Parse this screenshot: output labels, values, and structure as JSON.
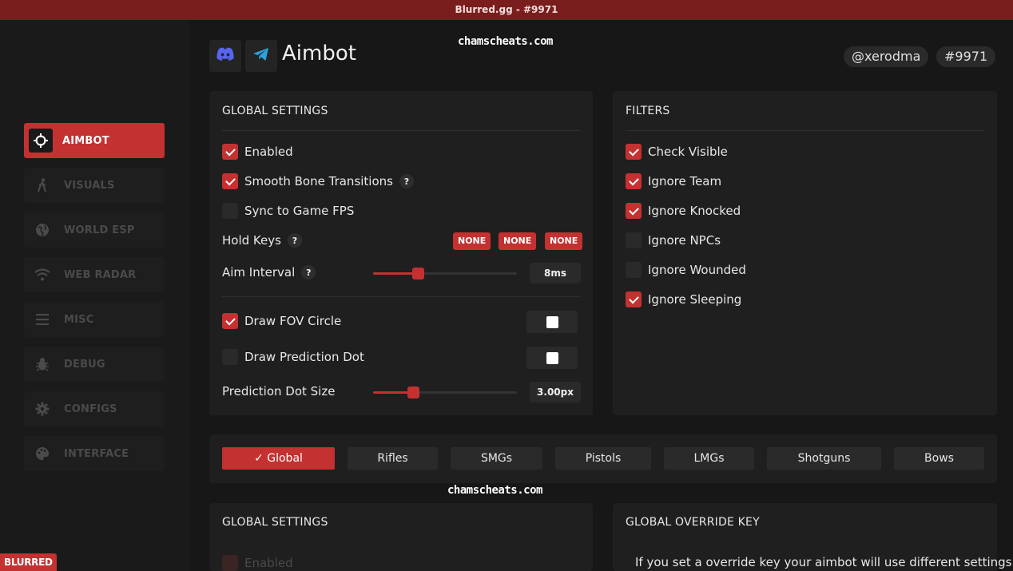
{
  "window": {
    "title": "Blurred.gg - #9971"
  },
  "watermark": {
    "text": "chamscheats.com"
  },
  "brand": {
    "badge": "BLURRED"
  },
  "header": {
    "title": "Aimbot",
    "user": "@xerodma",
    "tag": "#9971",
    "icons": [
      "discord-icon",
      "telegram-icon"
    ]
  },
  "sidebar": {
    "items": [
      {
        "label": "AIMBOT",
        "icon": "crosshair-icon",
        "active": true
      },
      {
        "label": "VISUALS",
        "icon": "person-walk-icon"
      },
      {
        "label": "WORLD ESP",
        "icon": "globe-icon"
      },
      {
        "label": "WEB RADAR",
        "icon": "wifi-icon"
      },
      {
        "label": "MISC",
        "icon": "menu-icon"
      },
      {
        "label": "DEBUG",
        "icon": "bug-icon"
      },
      {
        "label": "CONFIGS",
        "icon": "gear-icon"
      },
      {
        "label": "INTERFACE",
        "icon": "palette-icon"
      }
    ]
  },
  "global_settings": {
    "title": "GLOBAL SETTINGS",
    "enabled": {
      "label": "Enabled",
      "checked": true
    },
    "smooth": {
      "label": "Smooth Bone Transitions",
      "checked": true,
      "help": "?"
    },
    "sync_fps": {
      "label": "Sync to Game FPS",
      "checked": false
    },
    "hold_keys": {
      "label": "Hold Keys",
      "help": "?",
      "keys": [
        "NONE",
        "NONE",
        "NONE"
      ]
    },
    "aim_interval": {
      "label": "Aim Interval",
      "help": "?",
      "value": "8ms",
      "fraction": 0.31
    },
    "draw_fov": {
      "label": "Draw FOV Circle",
      "checked": true,
      "color": "#ffffff"
    },
    "draw_pred": {
      "label": "Draw Prediction Dot",
      "checked": false,
      "color": "#ffffff"
    },
    "pred_size": {
      "label": "Prediction Dot Size",
      "value": "3.00px",
      "fraction": 0.28
    }
  },
  "filters": {
    "title": "FILTERS",
    "items": [
      {
        "label": "Check Visible",
        "checked": true
      },
      {
        "label": "Ignore Team",
        "checked": true
      },
      {
        "label": "Ignore Knocked",
        "checked": true
      },
      {
        "label": "Ignore NPCs",
        "checked": false
      },
      {
        "label": "Ignore Wounded",
        "checked": false
      },
      {
        "label": "Ignore Sleeping",
        "checked": true
      }
    ]
  },
  "weapon_tabs": [
    {
      "label": "Global",
      "active": true
    },
    {
      "label": "Rifles"
    },
    {
      "label": "SMGs"
    },
    {
      "label": "Pistols"
    },
    {
      "label": "LMGs"
    },
    {
      "label": "Shotguns"
    },
    {
      "label": "Bows"
    }
  ],
  "bottom_global": {
    "title": "GLOBAL SETTINGS",
    "enabled_label": "Enabled"
  },
  "override": {
    "title": "GLOBAL OVERRIDE KEY",
    "text": "If you set a override key your aimbot will use different settings"
  },
  "colors": {
    "accent": "#c43131",
    "titlebar": "#7a1d1d"
  }
}
